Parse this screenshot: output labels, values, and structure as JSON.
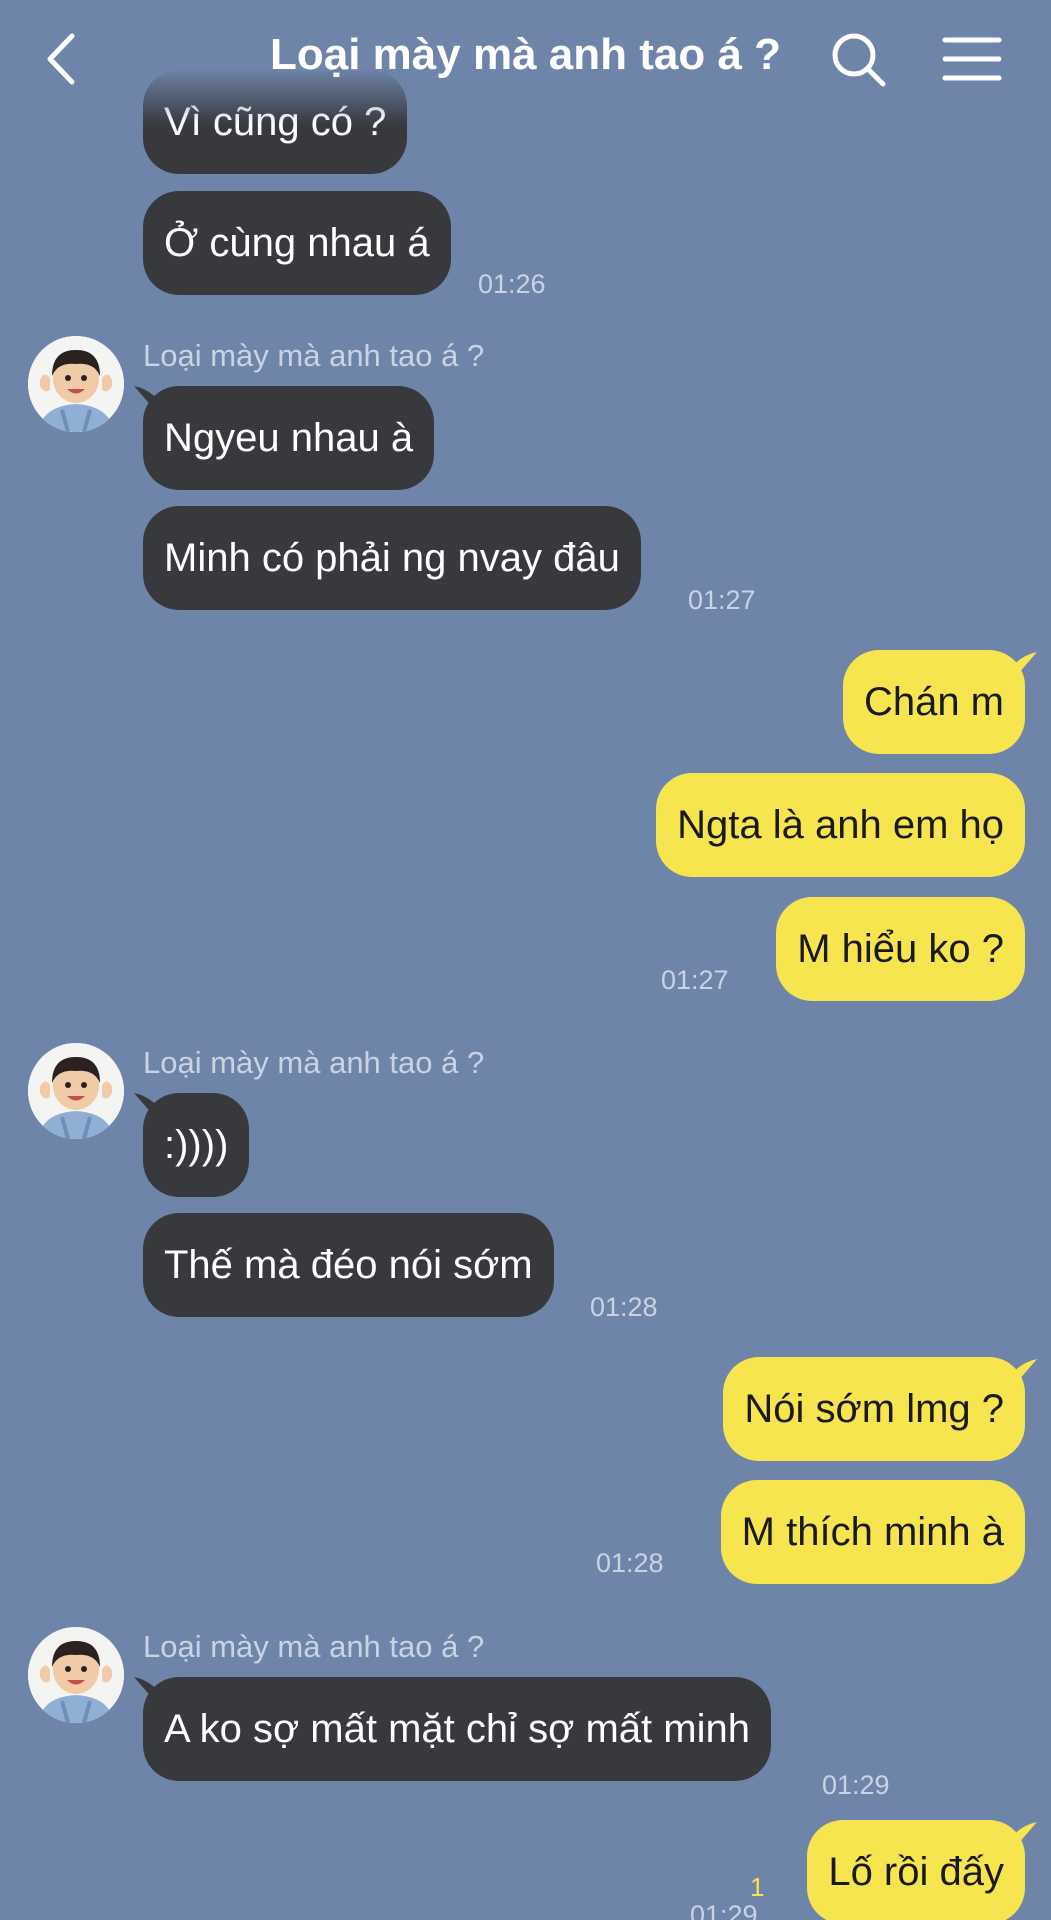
{
  "header": {
    "title": "Loại mày mà anh tao á ?",
    "back_icon": "chevron-left-icon",
    "search_icon": "search-icon",
    "menu_icon": "hamburger-menu-icon"
  },
  "colors": {
    "background": "#6e84a9",
    "incoming_bubble": "#38393d",
    "outgoing_bubble": "#f7e54f",
    "meta_text": "#c9d3e3"
  },
  "messages": {
    "top_partial": "Vì cũng có ?",
    "g1": {
      "text": "Ở cùng nhau á",
      "time": "01:26"
    },
    "g2": {
      "sender": "Loại mày mà anh tao á ?",
      "m1": "Ngyeu nhau à",
      "m2": "Minh có phải ng nvay đâu",
      "time": "01:27"
    },
    "g3": {
      "m1": "Chán m",
      "m2": "Ngta là anh em họ",
      "m3": "M hiểu ko ?",
      "time": "01:27"
    },
    "g4": {
      "sender": "Loại mày mà anh tao á ?",
      "m1": ":))))",
      "m2": "Thế mà đéo nói sớm",
      "time": "01:28"
    },
    "g5": {
      "m1": "Nói sớm lmg ?",
      "m2": "M thích minh à",
      "time": "01:28"
    },
    "g6": {
      "sender": "Loại mày mà anh tao á ?",
      "m1": "A ko sợ mất mặt chỉ sợ mất minh",
      "time": "01:29"
    },
    "g7": {
      "m1": "Lố rồi đấy",
      "read_count": "1",
      "time": "01:29"
    }
  }
}
